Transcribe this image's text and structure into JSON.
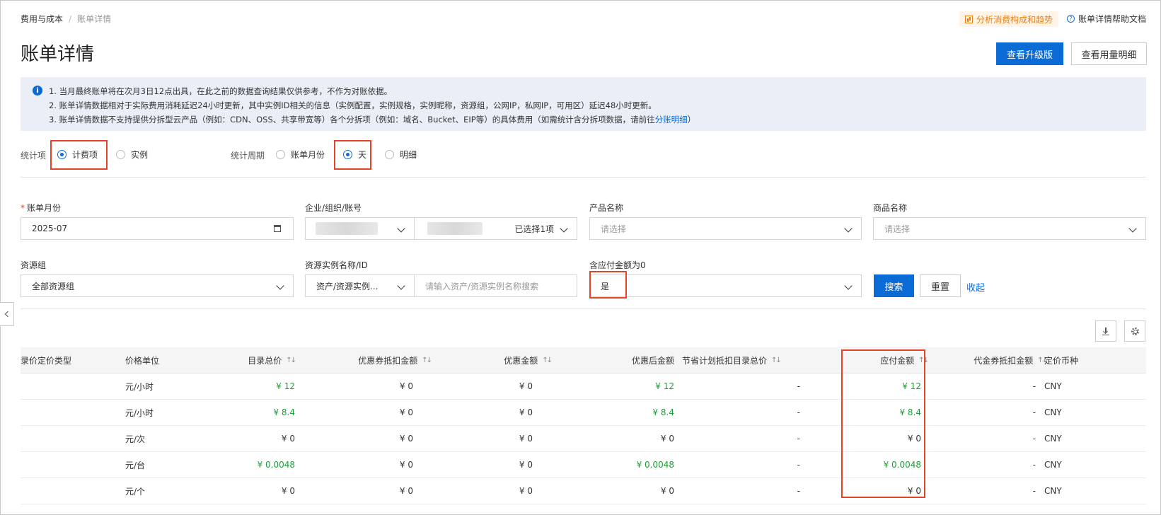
{
  "breadcrumb": {
    "parent": "费用与成本",
    "separator": "/",
    "current": "账单详情"
  },
  "header": {
    "trend_link": "分析消费构成和趋势",
    "help_link": "账单详情帮助文档",
    "title": "账单详情",
    "upgrade_button": "查看升级版",
    "usage_button": "查看用量明细"
  },
  "notice": {
    "line1": "1. 当月最终账单将在次月3日12点出具，在此之前的数据查询结果仅供参考，不作为对账依据。",
    "line2": "2. 账单详情数据相对于实际费用消耗延迟24小时更新，其中实例ID相关的信息（实例配置，实例规格，实例昵称，资源组，公网IP，私网IP，可用区）延迟48小时更新。",
    "line3_prefix": "3. 账单详情数据不支持提供分拆型云产品（例如：CDN、OSS、共享带宽等）各个分拆项（例如：域名、Bucket、EIP等）的具体费用（如需统计含分拆项数据，请前往",
    "line3_link": "分账明细",
    "line3_suffix": "）"
  },
  "stat_item": {
    "label": "统计项",
    "options": [
      "计费项",
      "实例"
    ],
    "selected": "计费项"
  },
  "stat_period": {
    "label": "统计周期",
    "options": [
      "账单月份",
      "天",
      "明细"
    ],
    "selected": "天"
  },
  "form": {
    "billing_month": {
      "label": "账单月份",
      "value": "2025-07"
    },
    "account": {
      "label": "企业/组织/账号",
      "selected_text": "已选择1项"
    },
    "product": {
      "label": "产品名称",
      "placeholder": "请选择"
    },
    "commodity": {
      "label": "商品名称",
      "placeholder": "请选择"
    },
    "resource_group": {
      "label": "资源组",
      "value": "全部资源组"
    },
    "instance": {
      "label": "资源实例名称/ID",
      "type_value": "资产/资源实例...",
      "placeholder": "请输入资产/资源实例名称搜索"
    },
    "include_zero": {
      "label": "含应付金额为0",
      "value": "是"
    },
    "search_button": "搜索",
    "reset_button": "重置",
    "collapse_link": "收起"
  },
  "table": {
    "headers": [
      "录价定价类型",
      "价格单位",
      "目录总价",
      "优惠券抵扣金额",
      "优惠金额",
      "优惠后金额",
      "节省计划抵扣目录总价",
      "应付金额",
      "代金券抵扣金额",
      "定价币种"
    ],
    "sortable": [
      false,
      false,
      true,
      true,
      true,
      false,
      true,
      true,
      true,
      false
    ],
    "rows": [
      {
        "price_type": "",
        "unit": "元/小时",
        "list_total": "¥ 12",
        "coupon": "¥ 0",
        "discount": "¥ 0",
        "after_discount": "¥ 12",
        "savings_plan": "-",
        "payable": "¥ 12",
        "voucher": "-",
        "currency": "CNY"
      },
      {
        "price_type": "",
        "unit": "元/小时",
        "list_total": "¥ 8.4",
        "coupon": "¥ 0",
        "discount": "¥ 0",
        "after_discount": "¥ 8.4",
        "savings_plan": "-",
        "payable": "¥ 8.4",
        "voucher": "-",
        "currency": "CNY"
      },
      {
        "price_type": "",
        "unit": "元/次",
        "list_total": "¥ 0",
        "coupon": "¥ 0",
        "discount": "¥ 0",
        "after_discount": "¥ 0",
        "savings_plan": "-",
        "payable": "¥ 0",
        "voucher": "-",
        "currency": "CNY"
      },
      {
        "price_type": "",
        "unit": "元/台",
        "list_total": "¥ 0.0048",
        "coupon": "¥ 0",
        "discount": "¥ 0",
        "after_discount": "¥ 0.0048",
        "savings_plan": "-",
        "payable": "¥ 0.0048",
        "voucher": "-",
        "currency": "CNY"
      },
      {
        "price_type": "",
        "unit": "元/个",
        "list_total": "¥ 0",
        "coupon": "¥ 0",
        "discount": "¥ 0",
        "after_discount": "¥ 0",
        "savings_plan": "-",
        "payable": "¥ 0",
        "voucher": "-",
        "currency": "CNY"
      }
    ]
  },
  "colors": {
    "primary": "#0a6ad6",
    "positive": "#1f9d3a",
    "highlight_box": "#e3452a",
    "trend_accent": "#e8801a"
  }
}
